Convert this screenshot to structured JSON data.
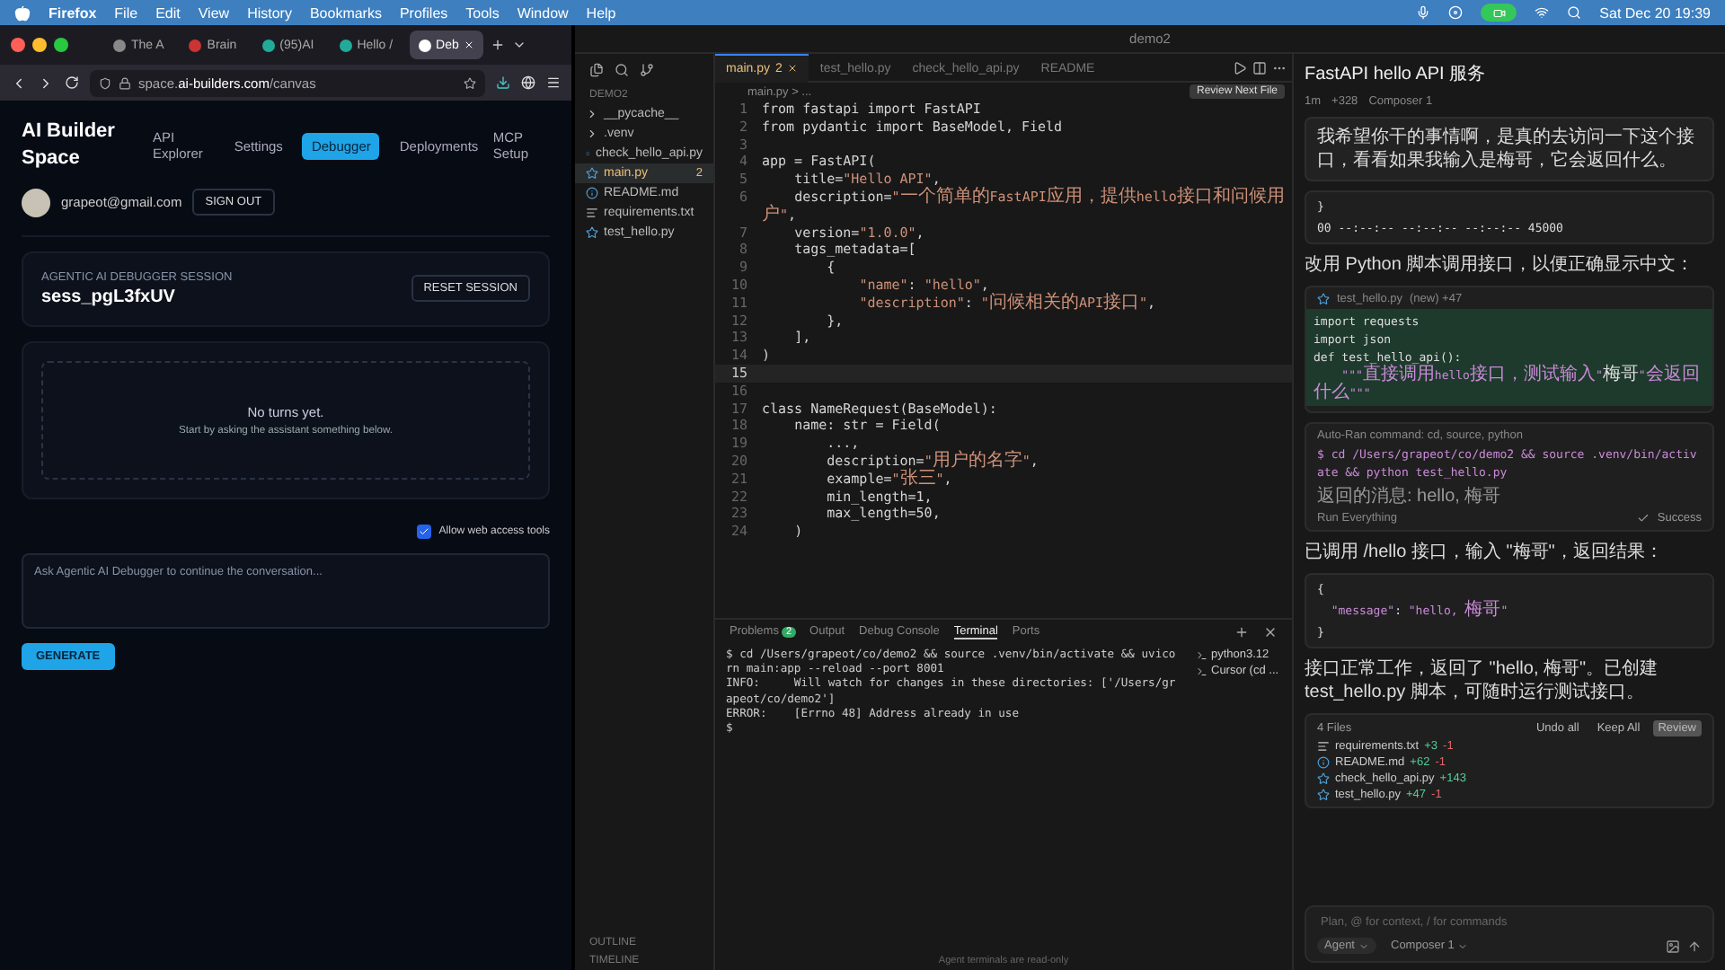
{
  "menubar": {
    "app": "Firefox",
    "menus": [
      "File",
      "Edit",
      "View",
      "History",
      "Bookmarks",
      "Profiles",
      "Tools",
      "Window",
      "Help"
    ],
    "clock": "Sat Dec 20  19:39"
  },
  "browser": {
    "tabs": [
      {
        "label": "The A",
        "selected": false
      },
      {
        "label": "Brain",
        "selected": false
      },
      {
        "label": "(95)AI",
        "selected": false
      },
      {
        "label": "Hello /",
        "selected": false
      },
      {
        "label": "Deb",
        "selected": true
      }
    ],
    "url": "space.**ai-builders.com**/canvas",
    "page": {
      "brand": "AI Builder Space",
      "nav": [
        {
          "label": "API Explorer",
          "selected": false
        },
        {
          "label": "Settings",
          "selected": false
        },
        {
          "label": "Debugger",
          "selected": true
        },
        {
          "label": "Deployments",
          "selected": false
        },
        {
          "label": "MCP Setup",
          "selected": false
        }
      ],
      "email": "grapeot@gmail.com",
      "sign_out": "SIGN OUT",
      "session": {
        "label": "AGENTIC AI DEBUGGER SESSION",
        "id": "sess_pgL3fxUV",
        "reset": "RESET SESSION"
      },
      "empty": {
        "title": "No turns yet.",
        "hint": "Start by asking the assistant something below."
      },
      "web_access": {
        "label": "Allow web access tools",
        "checked": true
      },
      "prompt": {
        "placeholder": "Ask Agentic AI Debugger to continue the conversation..."
      },
      "generate": "GENERATE"
    }
  },
  "editor": {
    "title": "demo2",
    "explorer": {
      "title": "DEMO2",
      "items": [
        {
          "name": "__pycache__",
          "kind": "folder",
          "selected": false
        },
        {
          "name": ".venv",
          "kind": "folder",
          "selected": false
        },
        {
          "name": "check_hello_api.py",
          "kind": "python",
          "selected": false
        },
        {
          "name": "main.py",
          "kind": "python",
          "selected": true,
          "badge": "2"
        },
        {
          "name": "README.md",
          "kind": "markdown",
          "selected": false
        },
        {
          "name": "requirements.txt",
          "kind": "text",
          "selected": false
        },
        {
          "name": "test_hello.py",
          "kind": "python",
          "selected": false
        }
      ],
      "sections": [
        "OUTLINE",
        "TIMELINE"
      ]
    },
    "tabs": [
      {
        "label": "main.py",
        "badge": "2",
        "selected": true
      },
      {
        "label": "test_hello.py",
        "selected": false
      },
      {
        "label": "check_hello_api.py",
        "selected": false
      },
      {
        "label": "README",
        "selected": false
      }
    ],
    "breadcrumb": "main.py > ...",
    "tooltip": "Review Next File",
    "lines": [
      {
        "n": "1",
        "text": "from fastapi import FastAPI",
        "selected": false
      },
      {
        "n": "2",
        "text": "from pydantic import BaseModel, Field",
        "selected": false
      },
      {
        "n": "3",
        "selected": false
      },
      {
        "n": "4",
        "text": "app = FastAPI(",
        "selected": false
      },
      {
        "n": "5",
        "text": "    title=\"Hello API\",",
        "selected": false
      },
      {
        "n": "6",
        "text": "    description=\"一个简单的FastAPI应用，提供hello接口和问候用户\",",
        "selected": false
      },
      {
        "n": "7",
        "text": "    version=\"1.0.0\",",
        "selected": false
      },
      {
        "n": "8",
        "text": "    tags_metadata=[",
        "selected": false
      },
      {
        "n": "9",
        "text": "        {",
        "selected": false
      },
      {
        "n": "10",
        "text": "            \"name\": \"hello\",",
        "selected": false
      },
      {
        "n": "11",
        "text": "            \"description\": \"问候相关的API接口\",",
        "selected": false
      },
      {
        "n": "12",
        "text": "        },",
        "selected": false
      },
      {
        "n": "13",
        "text": "    ],",
        "selected": false
      },
      {
        "n": "14",
        "text": ")",
        "selected": false
      },
      {
        "n": "15",
        "selected": true
      },
      {
        "n": "16",
        "selected": false
      },
      {
        "n": "17",
        "text": "class NameRequest(BaseModel):",
        "selected": false
      },
      {
        "n": "18",
        "text": "    name: str = Field(",
        "selected": false
      },
      {
        "n": "19",
        "text": "        ...,",
        "selected": false
      },
      {
        "n": "20",
        "text": "        description=\"用户的名字\",",
        "selected": false
      },
      {
        "n": "21",
        "text": "        example=\"张三\",",
        "selected": false
      },
      {
        "n": "22",
        "text": "        min_length=1,",
        "selected": false
      },
      {
        "n": "23",
        "text": "        max_length=50,",
        "selected": false
      },
      {
        "n": "24",
        "text": "    )",
        "selected": false
      }
    ]
  },
  "panel": {
    "tabs": [
      {
        "label": "Problems",
        "badge": "2",
        "selected": false
      },
      {
        "label": "Output",
        "selected": false
      },
      {
        "label": "Debug Console",
        "selected": false
      },
      {
        "label": "Terminal",
        "selected": true
      },
      {
        "label": "Ports",
        "selected": false
      }
    ],
    "terminal": [
      "$ cd /Users/grapeot/co/demo2 && source .venv/bin/activate && uvicorn main:app --reload --port 8001",
      "INFO:     Will watch for changes in these directories: ['/Users/grapeot/co/demo2']",
      "ERROR:    [Errno 48] Address already in use",
      "$ "
    ],
    "sessions": [
      "python3.12",
      "Cursor (cd ..."
    ],
    "status": "Agent terminals are read-only"
  },
  "chat": {
    "title": "FastAPI hello API 服务",
    "meta": [
      "1m",
      "+328",
      "Composer 1"
    ],
    "blocks": [
      {
        "kind": "user",
        "text": "我希望你干的事情啊，是真的去访问一下这个接口，看看如果我输入是梅哥，它会返回什么。"
      },
      {
        "kind": "snippet",
        "lines": [
          "}",
          "00 --:--:-- --:--:-- --:--:-- 45000"
        ]
      },
      {
        "kind": "text",
        "text": "改用 Python 脚本调用接口，以便正确显示中文："
      },
      {
        "kind": "file_code",
        "file": "test_hello.py",
        "tag": "(new) +47",
        "lines": [
          "import requests",
          "import json",
          "def test_hello_api():",
          "    \"\"\"直接调用hello接口，测试输入\"梅哥\"会返回什么\"\"\""
        ]
      },
      {
        "kind": "command",
        "title": "Auto-Ran command: cd, source, python",
        "command": "$ cd /Users/grapeot/co/demo2 && source .venv/bin/activate && python test_hello.py",
        "output": "返回的消息: hello, 梅哥",
        "mode": "Run Everything",
        "status": "Success"
      },
      {
        "kind": "text",
        "text": "已调用 /hello 接口，输入 \"梅哥\"，返回结果："
      },
      {
        "kind": "code",
        "lines": [
          "{",
          "  \"message\": \"hello, 梅哥\"",
          "}"
        ]
      },
      {
        "kind": "text",
        "text": "接口正常工作，返回了 \"hello, 梅哥\"。已创建 test_hello.py 脚本，可随时运行测试接口。"
      },
      {
        "kind": "files",
        "title": "4 Files",
        "actions": [
          "Undo all",
          "Keep All",
          "Review"
        ],
        "files": [
          {
            "name": "requirements.txt",
            "kind": "text",
            "added": "+3",
            "removed": "-1"
          },
          {
            "name": "README.md",
            "kind": "markdown",
            "added": "+62",
            "removed": "-1"
          },
          {
            "name": "check_hello_api.py",
            "kind": "python",
            "added": "+143"
          },
          {
            "name": "test_hello.py",
            "kind": "python",
            "added": "+47",
            "removed": "-1"
          }
        ]
      }
    ],
    "input": {
      "placeholder": "Plan, @ for context, / for commands"
    },
    "mode": "Agent",
    "model": "Composer 1"
  }
}
